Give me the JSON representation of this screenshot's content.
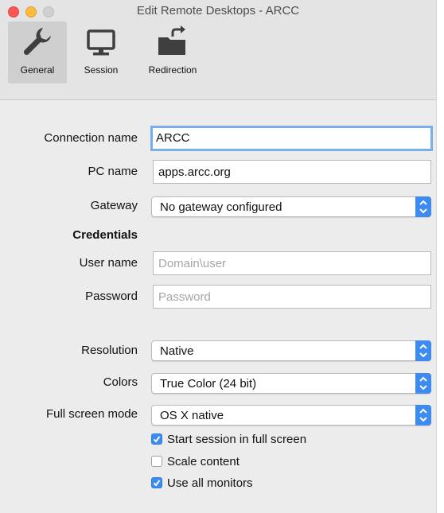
{
  "window": {
    "title": "Edit Remote Desktops - ARCC"
  },
  "toolbar": {
    "tabs": [
      {
        "label": "General",
        "icon": "wrench-icon",
        "selected": true
      },
      {
        "label": "Session",
        "icon": "monitor-icon",
        "selected": false
      },
      {
        "label": "Redirection",
        "icon": "folder-redirect-icon",
        "selected": false
      }
    ]
  },
  "form": {
    "connection_name": {
      "label": "Connection name",
      "value": "ARCC"
    },
    "pc_name": {
      "label": "PC name",
      "value": "apps.arcc.org"
    },
    "gateway": {
      "label": "Gateway",
      "value": "No gateway configured"
    },
    "credentials_heading": "Credentials",
    "user_name": {
      "label": "User name",
      "placeholder": "Domain\\user"
    },
    "password": {
      "label": "Password",
      "placeholder": "Password"
    },
    "resolution": {
      "label": "Resolution",
      "value": "Native"
    },
    "colors": {
      "label": "Colors",
      "value": "True Color (24 bit)"
    },
    "full_screen_mode": {
      "label": "Full screen mode",
      "value": "OS X native"
    },
    "checkboxes": [
      {
        "label": "Start session in full screen",
        "checked": true
      },
      {
        "label": "Scale content",
        "checked": false
      },
      {
        "label": "Use all monitors",
        "checked": true
      }
    ]
  },
  "colors": {
    "accent": "#3b8bf0",
    "focus_ring": "#7aaee8",
    "close": "#fc5753",
    "minimize": "#fdbc40"
  }
}
